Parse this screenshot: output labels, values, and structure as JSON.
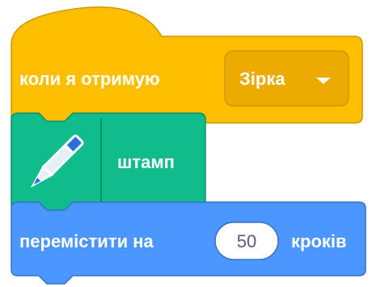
{
  "blocks": {
    "hat": {
      "label": "коли я отримую",
      "dropdown_value": "Зірка",
      "color": "#ffbf00",
      "border_color": "#cc9900"
    },
    "stamp": {
      "label": "штамп",
      "icon": "pen-icon",
      "color": "#0fbd8c",
      "border_color": "#0b8e69"
    },
    "move": {
      "label_before": "перемістити на",
      "steps_value": "50",
      "label_after": "кроків",
      "color": "#4c97ff",
      "border_color": "#3373cc"
    }
  }
}
